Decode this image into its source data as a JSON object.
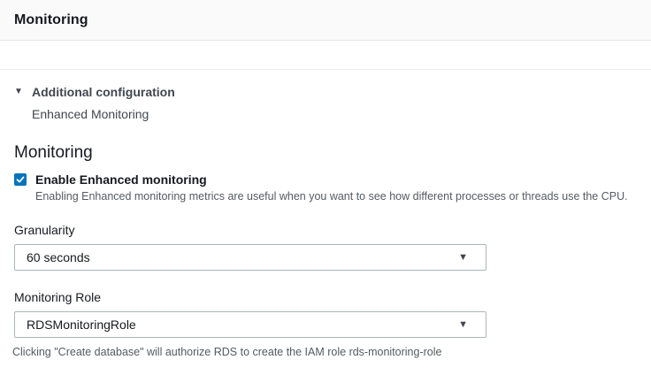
{
  "header": {
    "title": "Monitoring"
  },
  "icons": {
    "caret_down": "▼"
  },
  "additional_config": {
    "label": "Additional configuration",
    "expanded_item": "Enhanced Monitoring"
  },
  "section": {
    "title": "Monitoring",
    "enable_checkbox": {
      "label": "Enable Enhanced monitoring",
      "checked": true,
      "description": "Enabling Enhanced monitoring metrics are useful when you want to see how different processes or threads use the CPU."
    },
    "granularity": {
      "label": "Granularity",
      "value": "60 seconds"
    },
    "monitoring_role": {
      "label": "Monitoring Role",
      "value": "RDSMonitoringRole",
      "help": "Clicking \"Create database\" will authorize RDS to create the IAM role rds-monitoring-role"
    }
  },
  "colors": {
    "accent": "#0073bb",
    "header_bg": "#fafafa",
    "divider": "#eaeded",
    "select_border": "#aab7b8",
    "text": "#16191f",
    "secondary_text": "#545b64"
  }
}
